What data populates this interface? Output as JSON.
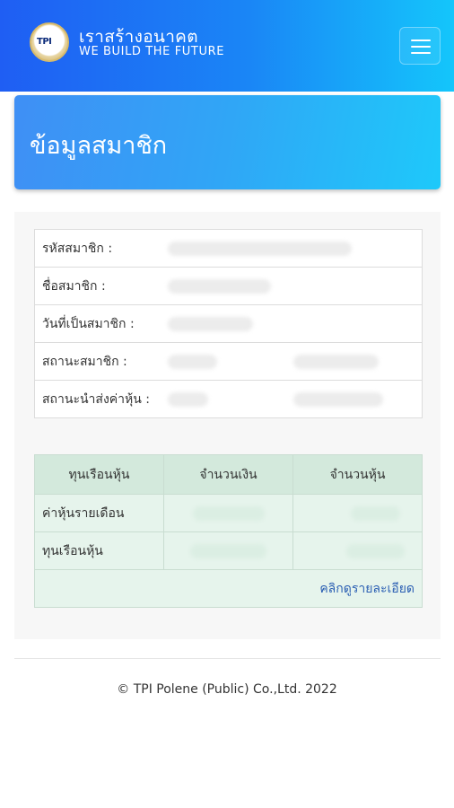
{
  "header": {
    "logo_text": "TPI",
    "brand_th": "เราสร้างอนาคต",
    "brand_en": "WE BUILD THE FUTURE",
    "menu_icon": "hamburger-icon",
    "gradient_colors": [
      "#1f5ef3",
      "#14c6fb"
    ]
  },
  "page": {
    "title": "ข้อมูลสมาชิก"
  },
  "member_info": {
    "rows": [
      {
        "label": "รหัสสมาชิก :"
      },
      {
        "label": "ชื่อสมาชิก :"
      },
      {
        "label": "วันที่เป็นสมาชิก :"
      },
      {
        "label": "สถานะสมาชิก :"
      },
      {
        "label": "สถานะนำส่งค่าหุ้น :"
      }
    ]
  },
  "shares": {
    "headers": [
      "ทุนเรือนหุ้น",
      "จำนวนเงิน",
      "จำนวนหุ้น"
    ],
    "rows": [
      {
        "label": "ค่าหุ้นรายเดือน"
      },
      {
        "label": "ทุนเรือนหุ้น"
      }
    ],
    "detail_link": "คลิกดูรายละเอียด",
    "header_color": "#d3e9dc",
    "row_color": "#e6f4ec",
    "link_color": "#2b5fb3"
  },
  "footer": {
    "copyright": "© TPI Polene (Public) Co.,Ltd. 2022"
  }
}
